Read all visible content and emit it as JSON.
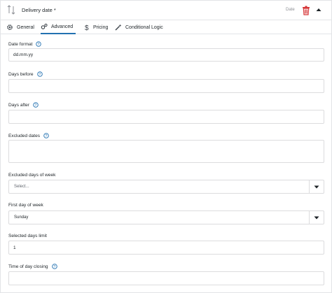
{
  "field": {
    "title": "Delivery date *",
    "type": "Date"
  },
  "tabs": [
    {
      "label": "General",
      "icon": "gear-icon"
    },
    {
      "label": "Advanced",
      "icon": "cogs-icon",
      "active": true
    },
    {
      "label": "Pricing",
      "icon": "dollar-icon"
    },
    {
      "label": "Conditional Logic",
      "icon": "magic-wand-icon"
    }
  ],
  "form": {
    "date_format": {
      "label": "Date format",
      "value": "dd.mm.yy",
      "help": true
    },
    "days_before": {
      "label": "Days before",
      "value": "",
      "help": true
    },
    "days_after": {
      "label": "Days after",
      "value": "",
      "help": true
    },
    "excluded_dates": {
      "label": "Excluded dates",
      "value": "",
      "help": true
    },
    "excluded_days_of_week": {
      "label": "Excluded days of week",
      "placeholder": "Select..."
    },
    "first_day_of_week": {
      "label": "First day of week",
      "value": "Sunday"
    },
    "selected_days_limit": {
      "label": "Selected days limit",
      "value": "1"
    },
    "time_of_day_closing": {
      "label": "Time of day closing",
      "value": "",
      "help": true
    }
  },
  "colors": {
    "accent": "#2271b1",
    "danger": "#d63638",
    "border": "#dcdcde"
  }
}
